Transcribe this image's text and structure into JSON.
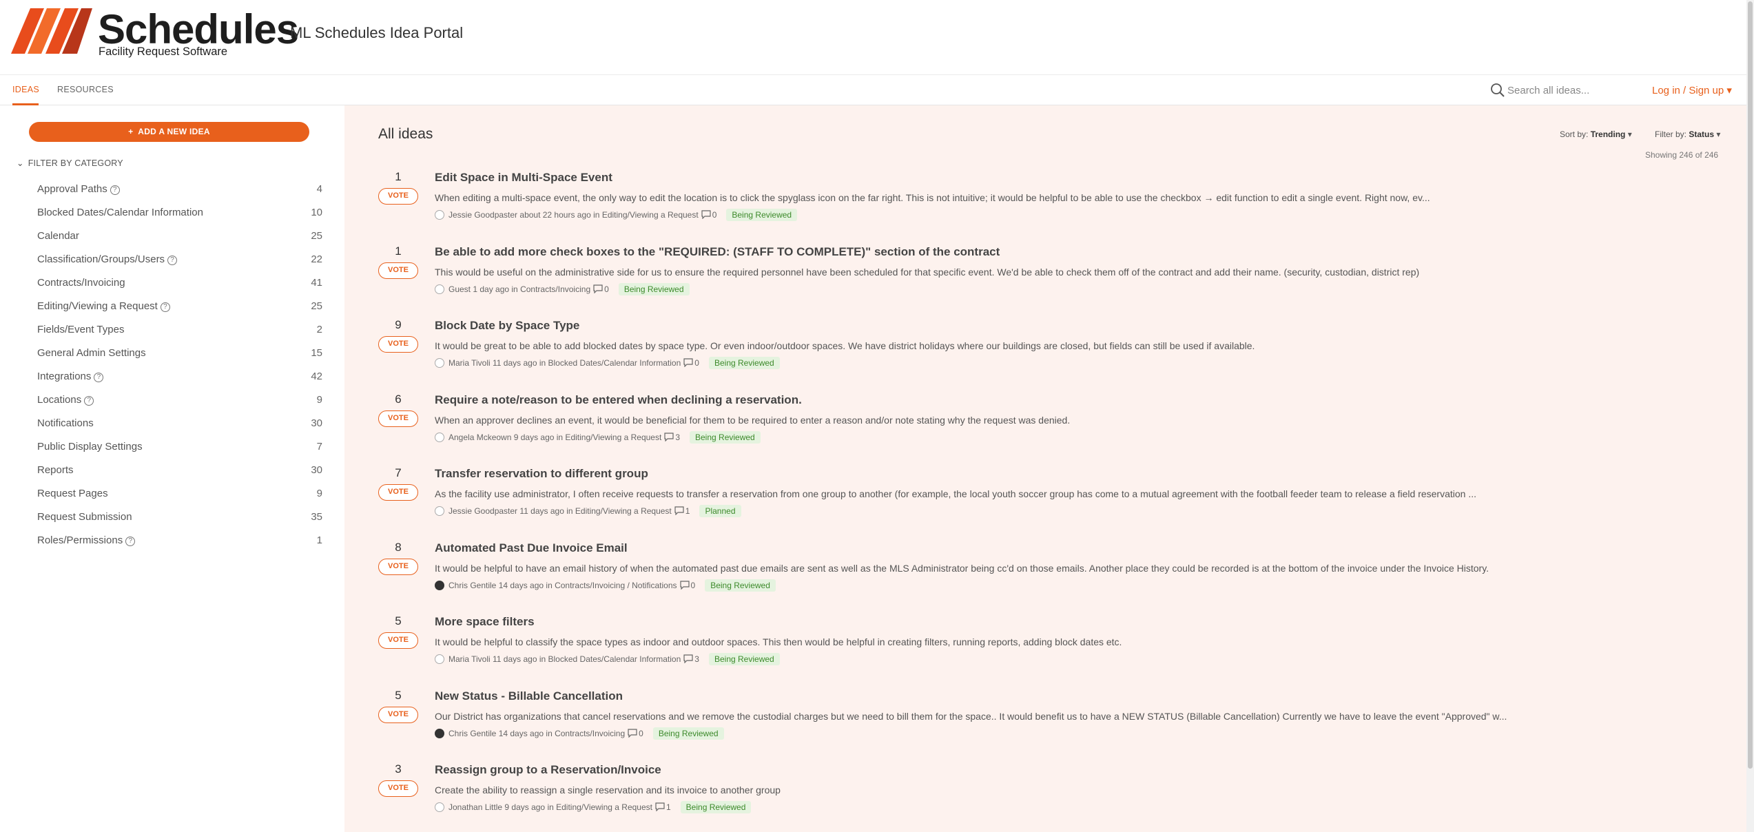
{
  "brand": {
    "logo_word": "Schedules",
    "logo_tagline": "Facility Request Software",
    "portal_title": "ML Schedules Idea Portal",
    "accent": "#e8601c"
  },
  "nav": {
    "tabs": [
      {
        "label": "IDEAS"
      },
      {
        "label": "RESOURCES"
      }
    ],
    "search_placeholder": "Search all ideas...",
    "login_label": "Log in / Sign up"
  },
  "sidebar": {
    "add_button": "ADD A NEW IDEA",
    "filter_heading": "FILTER BY CATEGORY",
    "categories": [
      {
        "label": "Approval Paths",
        "count": "4",
        "help": true
      },
      {
        "label": "Blocked Dates/Calendar Information",
        "count": "10",
        "help": false
      },
      {
        "label": "Calendar",
        "count": "25",
        "help": false
      },
      {
        "label": "Classification/Groups/Users",
        "count": "22",
        "help": true
      },
      {
        "label": "Contracts/Invoicing",
        "count": "41",
        "help": false
      },
      {
        "label": "Editing/Viewing a Request",
        "count": "25",
        "help": true
      },
      {
        "label": "Fields/Event Types",
        "count": "2",
        "help": false
      },
      {
        "label": "General Admin Settings",
        "count": "15",
        "help": false
      },
      {
        "label": "Integrations",
        "count": "42",
        "help": true
      },
      {
        "label": "Locations",
        "count": "9",
        "help": true
      },
      {
        "label": "Notifications",
        "count": "30",
        "help": false
      },
      {
        "label": "Public Display Settings",
        "count": "7",
        "help": false
      },
      {
        "label": "Reports",
        "count": "30",
        "help": false
      },
      {
        "label": "Request Pages",
        "count": "9",
        "help": false
      },
      {
        "label": "Request Submission",
        "count": "35",
        "help": false
      },
      {
        "label": "Roles/Permissions",
        "count": "1",
        "help": true
      }
    ]
  },
  "main": {
    "heading": "All ideas",
    "sort_prefix": "Sort by:",
    "sort_value": "Trending",
    "filter_prefix": "Filter by:",
    "filter_value": "Status",
    "showing": "Showing 246 of 246",
    "vote_label": "VOTE",
    "ideas": [
      {
        "votes": "1",
        "title": "Edit Space in Multi-Space Event",
        "desc": "When editing a multi-space event, the only way to edit the location is to click the spyglass icon on the far right. This is not intuitive; it would be helpful to be able to use the checkbox → edit function to edit a single event. Right now, ev...",
        "meta": "Jessie Goodpaster about 22 hours ago in Editing/Viewing a Request",
        "comments": "0",
        "status": "Being Reviewed",
        "avatar": "outline"
      },
      {
        "votes": "1",
        "title": "Be able to add more check boxes to the \"REQUIRED: (STAFF TO COMPLETE)\" section of the contract",
        "desc": "This would be useful on the administrative side for us to ensure the required personnel have been scheduled for that specific event. We'd be able to check them off of the contract and add their name. (security, custodian, district rep)",
        "meta": "Guest 1 day ago in Contracts/Invoicing",
        "comments": "0",
        "status": "Being Reviewed",
        "avatar": "outline"
      },
      {
        "votes": "9",
        "title": "Block Date by Space Type",
        "desc": "It would be great to be able to add blocked dates by space type. Or even indoor/outdoor spaces. We have district holidays where our buildings are closed, but fields can still be used if available.",
        "meta": "Maria Tivoli 11 days ago in Blocked Dates/Calendar Information",
        "comments": "0",
        "status": "Being Reviewed",
        "avatar": "outline"
      },
      {
        "votes": "6",
        "title": "Require a note/reason to be entered when declining a reservation.",
        "desc": "When an approver declines an event, it would be beneficial for them to be required to enter a reason and/or note stating why the request was denied.",
        "meta": "Angela Mckeown 9 days ago in Editing/Viewing a Request",
        "comments": "3",
        "status": "Being Reviewed",
        "avatar": "outline"
      },
      {
        "votes": "7",
        "title": "Transfer reservation to different group",
        "desc": "As the facility use administrator, I often receive requests to transfer a reservation from one group to another (for example, the local youth soccer group has come to a mutual agreement with the football feeder team to release a field reservation ...",
        "meta": "Jessie Goodpaster 11 days ago in Editing/Viewing a Request",
        "comments": "1",
        "status": "Planned",
        "avatar": "outline"
      },
      {
        "votes": "8",
        "title": "Automated Past Due Invoice Email",
        "desc": "It would be helpful to have an email history of when the automated past due emails are sent as well as the MLS Administrator being cc'd on those emails. Another place they could be recorded is at the bottom of the invoice under the Invoice History.",
        "meta": "Chris Gentile 14 days ago in Contracts/Invoicing / Notifications",
        "comments": "0",
        "status": "Being Reviewed",
        "avatar": "dark"
      },
      {
        "votes": "5",
        "title": "More space filters",
        "desc": "It would be helpful to classify the space types as indoor and outdoor spaces. This then would be helpful in creating filters, running reports, adding block dates etc.",
        "meta": "Maria Tivoli 11 days ago in Blocked Dates/Calendar Information",
        "comments": "3",
        "status": "Being Reviewed",
        "avatar": "outline"
      },
      {
        "votes": "5",
        "title": "New Status - Billable Cancellation",
        "desc": "Our District has organizations that cancel reservations and we remove the custodial charges but we need to bill them for the space.. It would benefit us to have a NEW STATUS (Billable Cancellation) Currently we have to leave the event \"Approved\" w...",
        "meta": "Chris Gentile 14 days ago in Contracts/Invoicing",
        "comments": "0",
        "status": "Being Reviewed",
        "avatar": "dark"
      },
      {
        "votes": "3",
        "title": "Reassign group to a Reservation/Invoice",
        "desc": "Create the ability to reassign a single reservation and its invoice to another group",
        "meta": "Jonathan Little 9 days ago in Editing/Viewing a Request",
        "comments": "1",
        "status": "Being Reviewed",
        "avatar": "outline"
      }
    ]
  }
}
